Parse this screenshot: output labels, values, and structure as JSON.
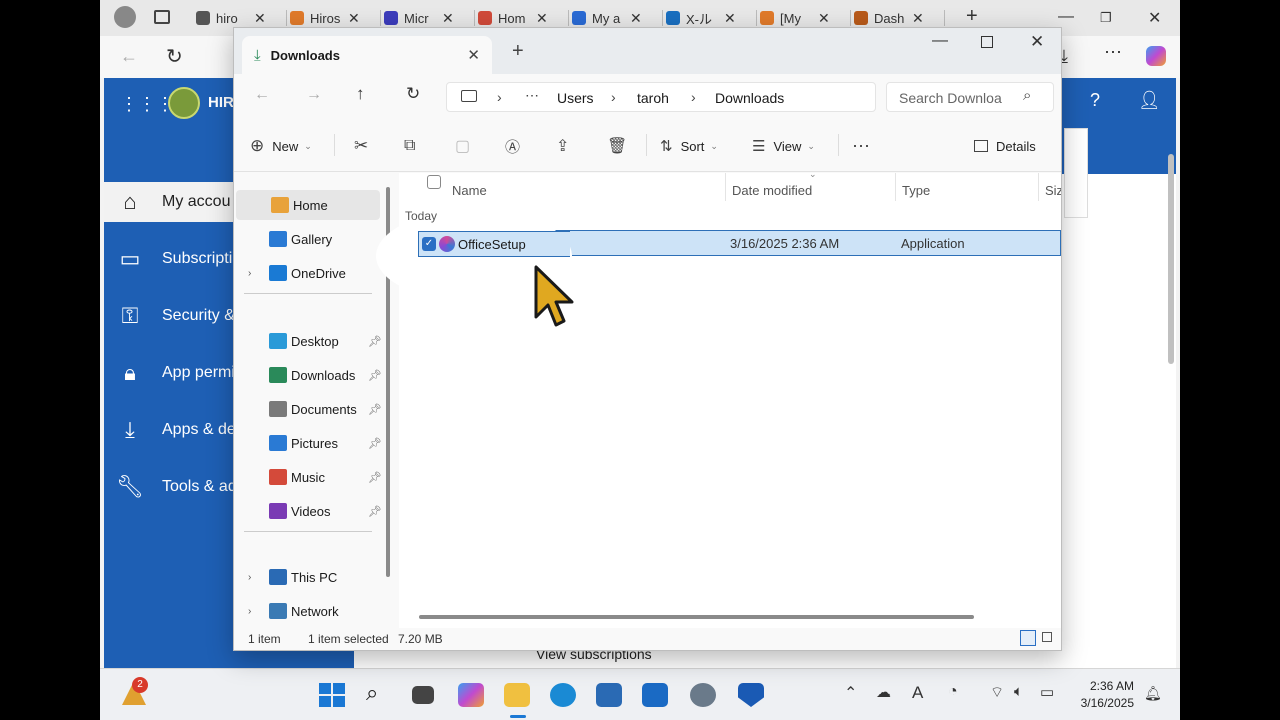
{
  "browser": {
    "tabs": [
      {
        "label": "hiro",
        "color": "#555"
      },
      {
        "label": "Hiros",
        "color": "#e07a2a"
      },
      {
        "label": "Micr",
        "color": "#3c3cbb"
      },
      {
        "label": "Hom",
        "color": "#d04a3a"
      },
      {
        "label": "My a",
        "color": "#2a6ad4"
      },
      {
        "label": "X-ル",
        "color": "#1a6fc0"
      },
      {
        "label": "[My",
        "color": "#e07a2a"
      },
      {
        "label": "Dash",
        "color": "#b85a1a"
      }
    ]
  },
  "webpage": {
    "brand": "HIRO",
    "nav": [
      {
        "label": "My accou",
        "icon": "home-icon"
      },
      {
        "label": "Subscripti",
        "icon": "card-icon"
      },
      {
        "label": "Security &",
        "icon": "key-icon"
      },
      {
        "label": "App permi",
        "icon": "lock-icon"
      },
      {
        "label": "Apps & de",
        "icon": "download-icon"
      },
      {
        "label": "Tools & ad",
        "icon": "wrench-icon"
      }
    ],
    "bottom_link": "View subscriptions"
  },
  "explorer": {
    "tab_title": "Downloads",
    "breadcrumb": [
      "Users",
      "taroh",
      "Downloads"
    ],
    "search_placeholder": "Search Downloa",
    "commands": {
      "new": "New",
      "sort": "Sort",
      "view": "View",
      "details": "Details"
    },
    "sidebar": [
      {
        "label": "Home",
        "color": "#e8a23a",
        "pinned": false,
        "selected": true
      },
      {
        "label": "Gallery",
        "color": "#2a7ad4",
        "pinned": false
      },
      {
        "label": "OneDrive",
        "color": "#1a7ad4",
        "pinned": false,
        "expandable": true
      },
      {
        "label": "Desktop",
        "color": "#2a9ad8",
        "pinned": true
      },
      {
        "label": "Downloads",
        "color": "#2a8a5a",
        "pinned": true
      },
      {
        "label": "Documents",
        "color": "#7a7a7a",
        "pinned": true
      },
      {
        "label": "Pictures",
        "color": "#2a7ad4",
        "pinned": true
      },
      {
        "label": "Music",
        "color": "#d44a3a",
        "pinned": true
      },
      {
        "label": "Videos",
        "color": "#7a3ab4",
        "pinned": true
      },
      {
        "label": "This PC",
        "color": "#2a6ab4",
        "pinned": false,
        "expandable": true
      },
      {
        "label": "Network",
        "color": "#3a7ab4",
        "pinned": false,
        "expandable": true
      }
    ],
    "columns": [
      "Name",
      "Date modified",
      "Type",
      "Siz"
    ],
    "group_label": "Today",
    "files": [
      {
        "name": "OfficeSetup",
        "date": "3/16/2025 2:36 AM",
        "type": "Application"
      }
    ],
    "status": {
      "count": "1 item",
      "selected": "1 item selected",
      "size": "7.20 MB"
    }
  },
  "taskbar": {
    "badge": "2",
    "time": "2:36 AM",
    "date": "3/16/2025"
  }
}
